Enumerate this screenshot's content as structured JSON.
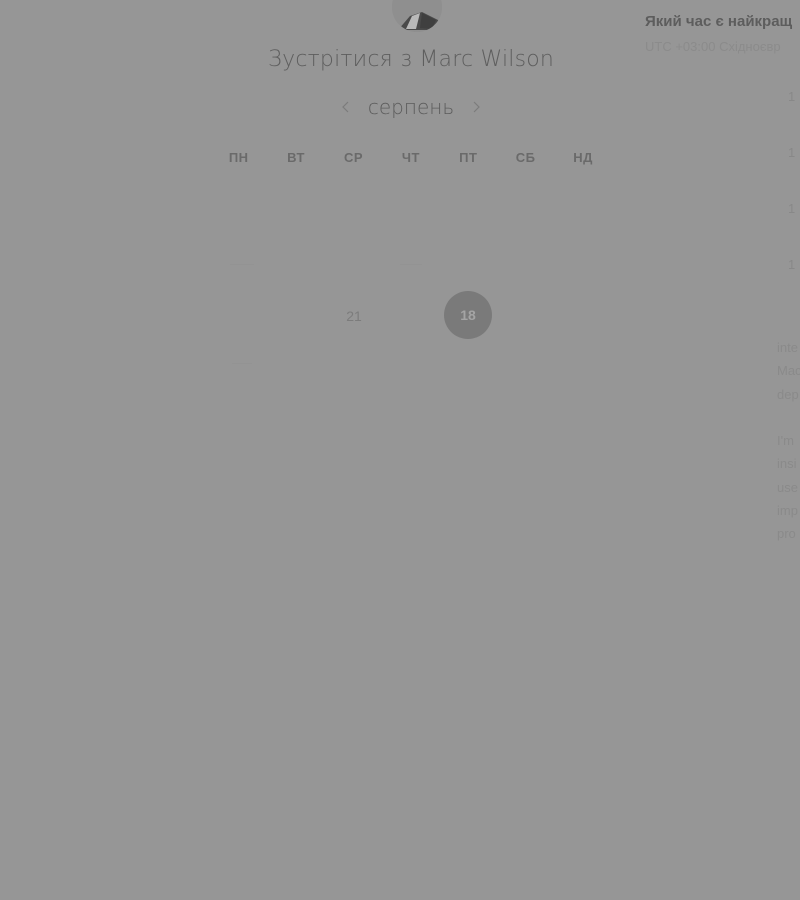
{
  "host": {
    "title": "Зустрітися з Marc Wilson"
  },
  "calendar": {
    "month_label": "серпень",
    "weekdays": [
      "ПН",
      "ВТ",
      "СР",
      "ЧТ",
      "ПТ",
      "СБ",
      "НД"
    ],
    "visible_day": "21",
    "selected_day": "18"
  },
  "side_panel": {
    "heading": "Який час є найкращ",
    "timezone": "UTC +03:00 Східноєвр",
    "slot_prefix": "1",
    "description_lines": [
      "inte",
      "Mac",
      "dep",
      "",
      "I'm",
      "insi",
      "use",
      "imp",
      "pro"
    ]
  },
  "colors": {
    "overlay_background": "#969696",
    "selected_day_fill": "#7a7a7a"
  }
}
